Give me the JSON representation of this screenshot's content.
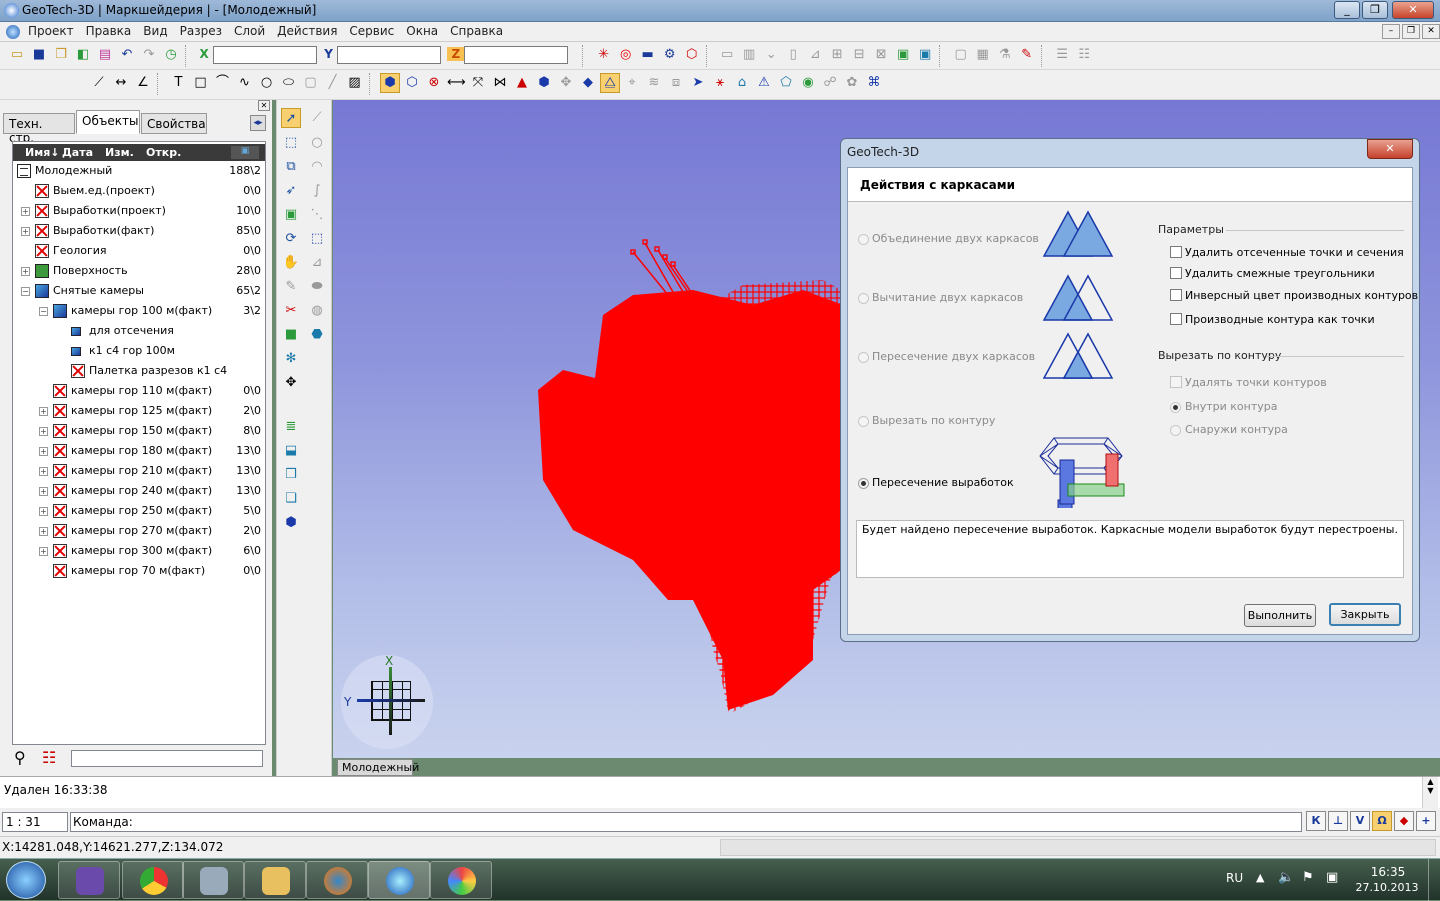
{
  "window": {
    "title": "GeoTech-3D | Маркшейдерия | - [Молодежный]"
  },
  "menu": [
    "Проект",
    "Правка",
    "Вид",
    "Разрез",
    "Слой",
    "Действия",
    "Сервис",
    "Окна",
    "Справка"
  ],
  "toolbar": {
    "label_x": "X",
    "label_y": "Y",
    "label_z": "Z",
    "x_value": "",
    "y_value": "",
    "z_value": ""
  },
  "left_panel": {
    "tabs": [
      "Техн. стр.",
      "Объекты",
      "Свойства"
    ],
    "active_tab": "Объекты",
    "columns": {
      "name": "Имя↓",
      "date": "Дата",
      "changed": "Изм.",
      "opened": "Откр."
    },
    "tree": [
      {
        "label": "Молодежный",
        "value": "188\\2"
      },
      {
        "label": "Выем.ед.(проект)",
        "value": "0\\0"
      },
      {
        "label": "Выработки(проект)",
        "value": "10\\0"
      },
      {
        "label": "Выработки(факт)",
        "value": "85\\0"
      },
      {
        "label": "Геология",
        "value": "0\\0"
      },
      {
        "label": "Поверхность",
        "value": "28\\0"
      },
      {
        "label": "Снятые камеры",
        "value": "65\\2"
      },
      {
        "label": "камеры гор 100 м(факт)",
        "value": "3\\2"
      },
      {
        "label": "для отсечения",
        "value": ""
      },
      {
        "label": "к1 с4 гор 100м",
        "value": ""
      },
      {
        "label": "Палетка разрезов к1 с4",
        "value": ""
      },
      {
        "label": "камеры гор 110 м(факт)",
        "value": "0\\0"
      },
      {
        "label": "камеры гор 125 м(факт)",
        "value": "2\\0"
      },
      {
        "label": "камеры гор 150 м(факт)",
        "value": "8\\0"
      },
      {
        "label": "камеры гор 180 м(факт)",
        "value": "13\\0"
      },
      {
        "label": "камеры гор 210 м(факт)",
        "value": "13\\0"
      },
      {
        "label": "камеры гор 240 м(факт)",
        "value": "13\\0"
      },
      {
        "label": "камеры гор 250 м(факт)",
        "value": "5\\0"
      },
      {
        "label": "камеры гор 270 м(факт)",
        "value": "2\\0"
      },
      {
        "label": "камеры гор 300 м(факт)",
        "value": "6\\0"
      },
      {
        "label": "камеры гор 70 м(факт)",
        "value": "0\\0"
      }
    ]
  },
  "viewport": {
    "tab_label": "Молодежный",
    "axis_x": "X",
    "axis_y": "Y",
    "model_color": "#ff0000"
  },
  "dialog": {
    "title": "GeoTech-3D",
    "header": "Действия с каркасами",
    "operations": [
      {
        "label": "Объединение двух каркасов",
        "selected": false,
        "enabled": false
      },
      {
        "label": "Вычитание двух каркасов",
        "selected": false,
        "enabled": false
      },
      {
        "label": "Пересечение двух каркасов",
        "selected": false,
        "enabled": false
      },
      {
        "label": "Вырезать по контуру",
        "selected": false,
        "enabled": false
      },
      {
        "label": "Пересечение выработок",
        "selected": true,
        "enabled": true
      }
    ],
    "params_title": "Параметры",
    "params": [
      {
        "label": "Удалить отсеченные точки и сечения",
        "checked": false
      },
      {
        "label": "Удалить смежные треугольники",
        "checked": false
      },
      {
        "label": "Инверсный цвет производных контуров",
        "checked": false
      },
      {
        "label": "Производные контура как точки",
        "checked": false
      }
    ],
    "cut_title": "Вырезать по контуру",
    "cut_check": {
      "label": "Удалять точки контуров",
      "checked": false,
      "enabled": false
    },
    "cut_radios": [
      {
        "label": "Внутри контура",
        "selected": true,
        "enabled": false
      },
      {
        "label": "Снаружи контура",
        "selected": false,
        "enabled": false
      }
    ],
    "description": "Будет найдено пересечение выработок. Каркасные модели выработок будут перестроены.",
    "buttons": {
      "run": "Выполнить",
      "close": "Закрыть"
    }
  },
  "log": {
    "line": "Удален 16:33:38"
  },
  "command": {
    "scale": "1 : 31",
    "label": "Команда:",
    "value": "",
    "snap_buttons": [
      "К",
      "⊥",
      "V",
      "Ω",
      "◆",
      "+"
    ]
  },
  "status": {
    "coords": "X:14281.048,Y:14621.277,Z:134.072"
  },
  "taskbar": {
    "lang": "RU",
    "time": "16:35",
    "date": "27.10.2013"
  }
}
